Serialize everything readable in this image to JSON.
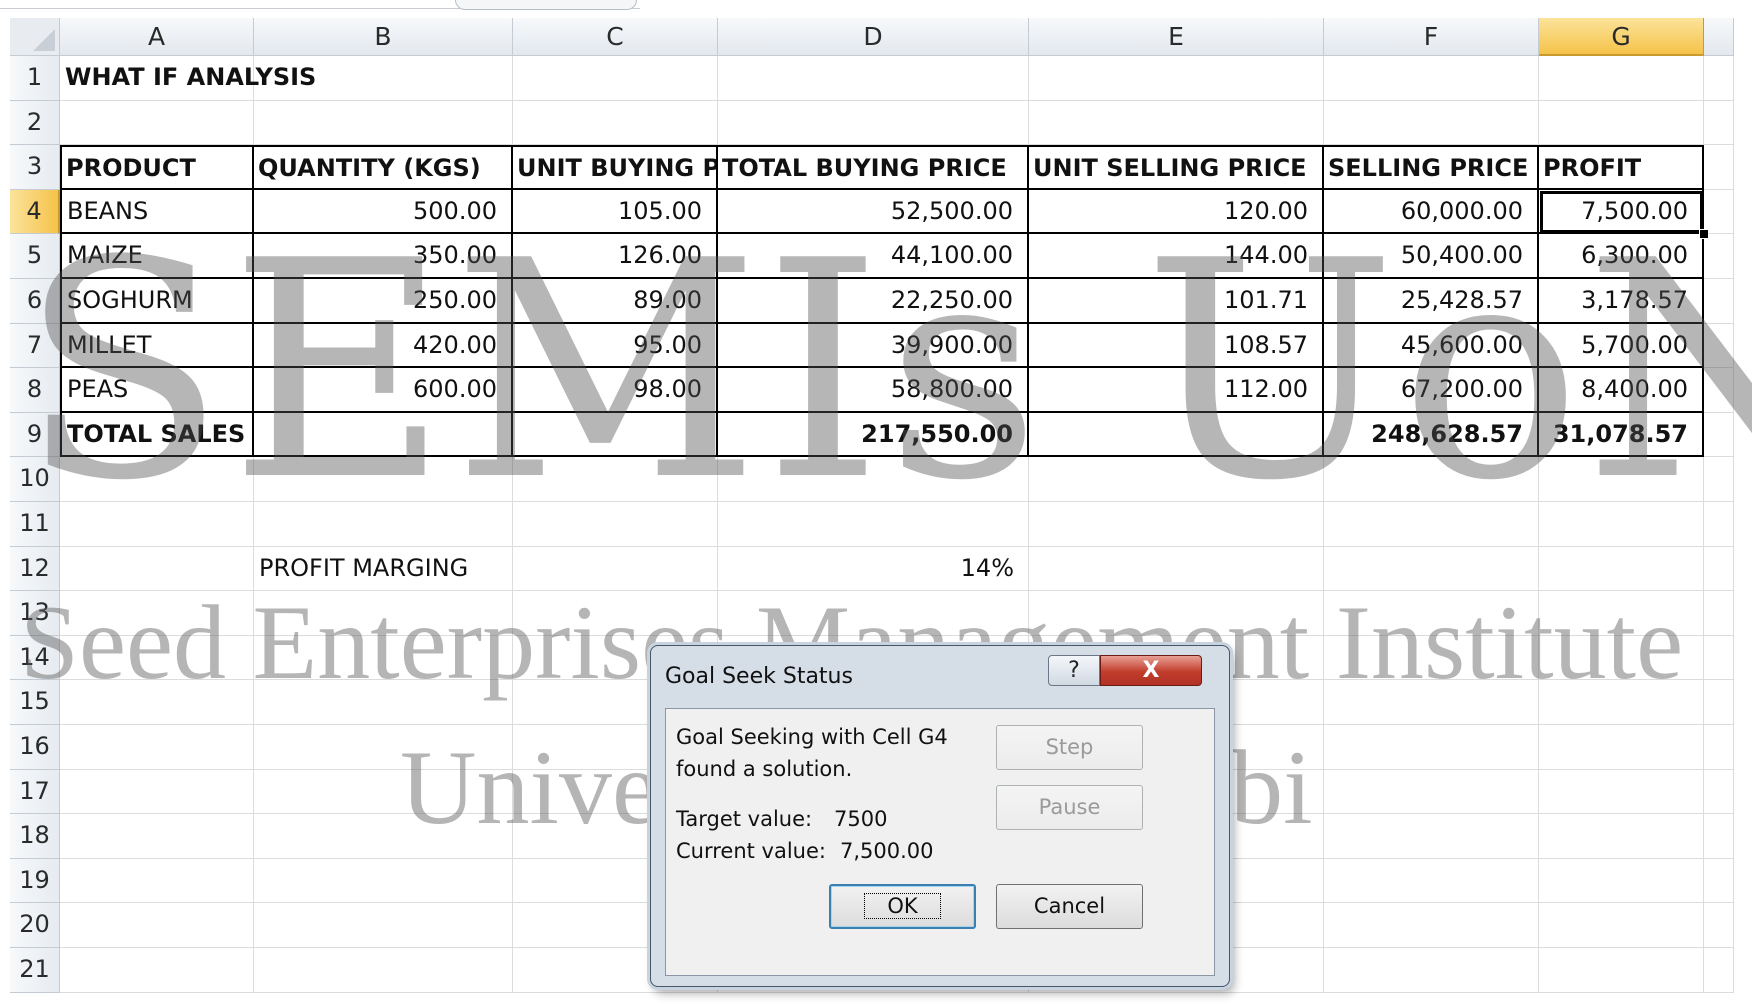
{
  "columns": [
    "A",
    "B",
    "C",
    "D",
    "E",
    "F",
    "G"
  ],
  "selected_column": "G",
  "selected_row": "4",
  "rows": [
    "1",
    "2",
    "3",
    "4",
    "5",
    "6",
    "7",
    "8",
    "9",
    "10",
    "11",
    "12",
    "13",
    "14",
    "15",
    "16",
    "17",
    "18",
    "19",
    "20",
    "21"
  ],
  "sheet": {
    "title": "WHAT IF ANALYSIS",
    "headers": [
      "PRODUCT",
      "QUANTITY (KGS)",
      "UNIT BUYING PRICE",
      "TOTAL BUYING PRICE",
      "UNIT SELLING PRICE",
      "SELLING PRICE",
      "PROFIT"
    ],
    "data_rows": [
      [
        "BEANS",
        "500.00",
        "105.00",
        "52,500.00",
        "120.00",
        "60,000.00",
        "7,500.00"
      ],
      [
        "MAIZE",
        "350.00",
        "126.00",
        "44,100.00",
        "144.00",
        "50,400.00",
        "6,300.00"
      ],
      [
        "SOGHURM",
        "250.00",
        "89.00",
        "22,250.00",
        "101.71",
        "25,428.57",
        "3,178.57"
      ],
      [
        "MILLET",
        "420.00",
        "95.00",
        "39,900.00",
        "108.57",
        "45,600.00",
        "5,700.00"
      ],
      [
        "PEAS",
        "600.00",
        "98.00",
        "58,800.00",
        "112.00",
        "67,200.00",
        "8,400.00"
      ]
    ],
    "totals": [
      "TOTAL SALES",
      "",
      "",
      "217,550.00",
      "",
      "248,628.57",
      "31,078.57"
    ],
    "profit_margin_label": "PROFIT MARGING",
    "profit_margin_value": "14%"
  },
  "watermark": {
    "line1": "SEMIs UoN",
    "line2": "Seed Enterprises Management Institute",
    "line3": "University of Nairobi"
  },
  "dialog": {
    "title": "Goal Seek Status",
    "help_label": "?",
    "close_label": "X",
    "message_line1": "Goal Seeking with Cell G4",
    "message_line2": "found a solution.",
    "target_label": "Target value:",
    "target_value": "7500",
    "current_label": "Current value:",
    "current_value": "7,500.00",
    "step_label": "Step",
    "pause_label": "Pause",
    "ok_label": "OK",
    "cancel_label": "Cancel"
  }
}
